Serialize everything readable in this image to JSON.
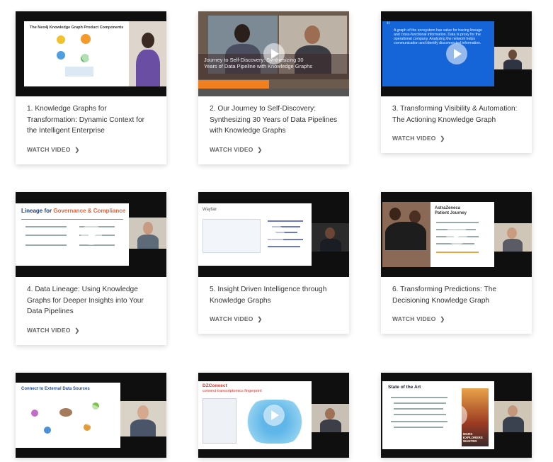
{
  "watch_label": "WATCH VIDEO",
  "cards": [
    {
      "title": "1. Knowledge Graphs for Transformation: Dynamic Context for the Intelligent Enterprise",
      "slide_heading": "The Neo4j Knowledge Graph Product Components"
    },
    {
      "title": "2. Our Journey to Self-Discovery: Synthesizing 30 Years of Data Pipelines with Knowledge Graphs",
      "overlay_text": "Journey to Self-Discovery: Synthesizing 30 Years of Data Pipeline with Knowledge Graphs"
    },
    {
      "title": "3. Transforming Visibility & Automation: The Actioning Knowledge Graph",
      "quote_text": "A graph of the ecosystem has value for tracing lineage and cross-functional information. Data is proxy for the operational company. Analyzing the network helps communication and identify disconnected information."
    },
    {
      "title": "4. Data Lineage: Using Knowledge Graphs for Deeper Insights into Your Data Pipelines",
      "slide_heading_a": "Lineage for ",
      "slide_heading_b": "Governance & Compliance"
    },
    {
      "title": "5. Insight Driven Intelligence through Knowledge Graphs",
      "slide_heading": "Wayfair"
    },
    {
      "title": "6. Transforming Predictions: The Decisioning Knowledge Graph",
      "slide_heading": "AstraZeneca Patient Journey"
    },
    {
      "title": "",
      "slide_heading": "Connect to External Data Sources"
    },
    {
      "title": "",
      "slide_heading": "DZConnect",
      "slide_sub": "connect transcriptomics fingerprint"
    },
    {
      "title": "",
      "slide_heading": "State of the Art",
      "poster_text": "MARS EXPLORERS WANTED"
    }
  ]
}
